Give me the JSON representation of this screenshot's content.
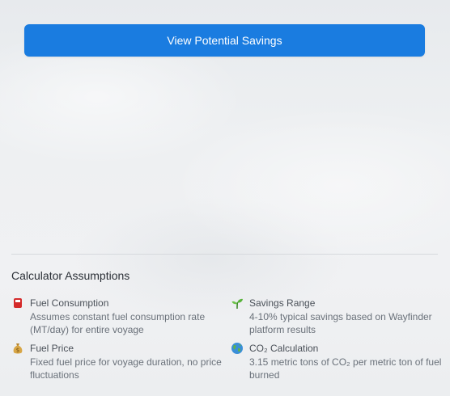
{
  "cta_button": {
    "label": "View Potential Savings"
  },
  "assumptions": {
    "title": "Calculator Assumptions",
    "items": [
      {
        "icon": "fuel-pump-icon",
        "title": "Fuel Consumption",
        "description": "Assumes constant fuel consumption rate (MT/day) for entire voyage"
      },
      {
        "icon": "seedling-icon",
        "title": "Savings Range",
        "description": "4-10% typical savings based on Wayfinder platform results"
      },
      {
        "icon": "money-bag-icon",
        "title": "Fuel Price",
        "description": "Fixed fuel price for voyage duration, no price fluctuations"
      },
      {
        "icon": "globe-icon",
        "title": "CO₂ Calculation",
        "description": "3.15 metric tons of CO₂ per metric ton of fuel burned"
      }
    ]
  },
  "colors": {
    "accent": "#1a7ce0",
    "background": "#eef0f2",
    "divider": "#d6d9dd"
  }
}
